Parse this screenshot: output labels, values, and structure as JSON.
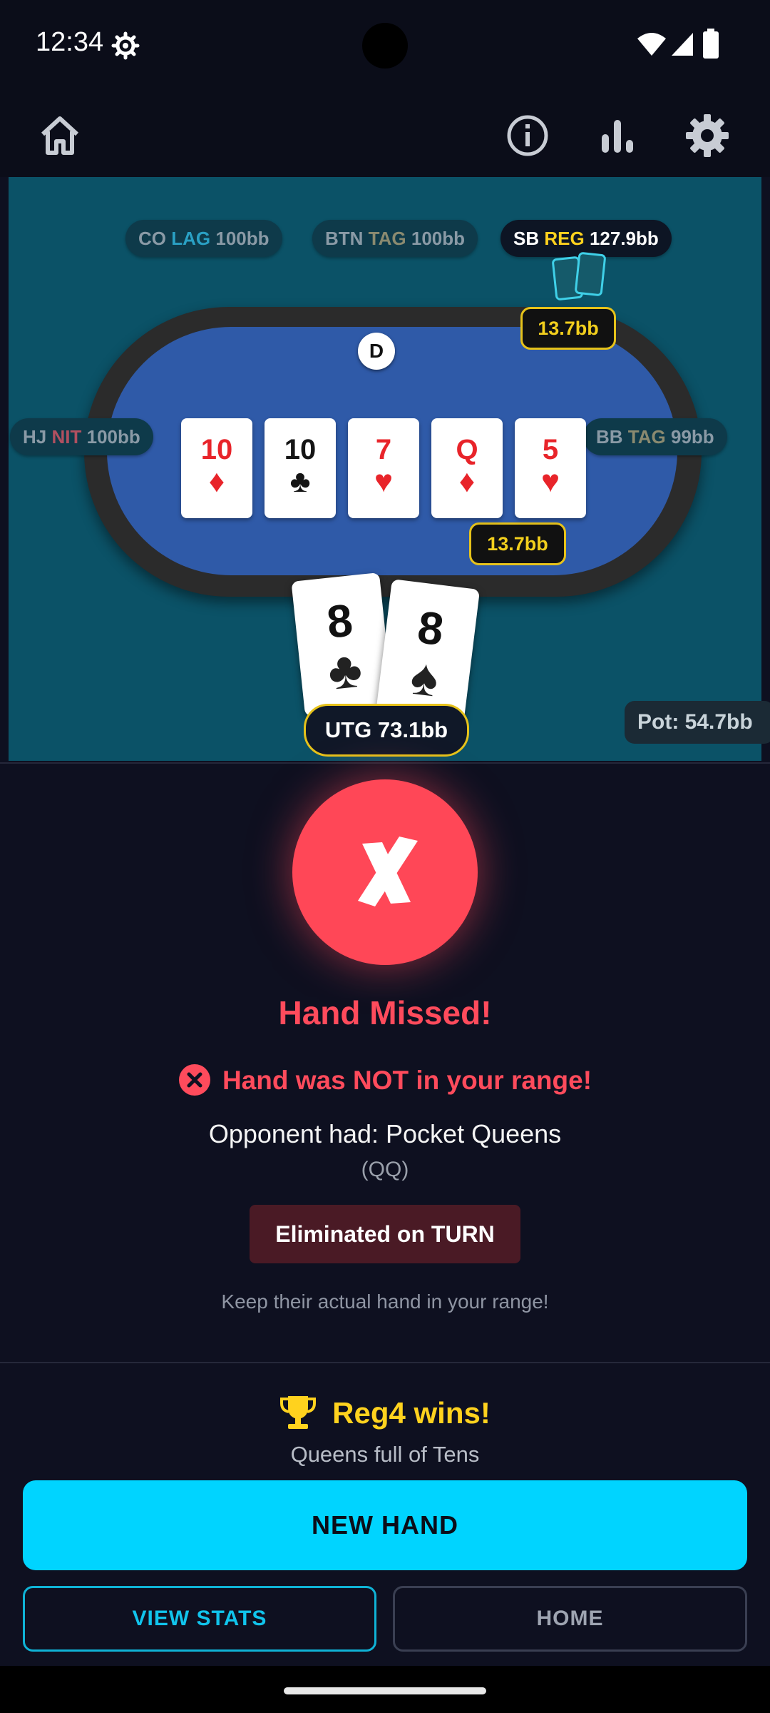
{
  "status_bar": {
    "time": "12:34"
  },
  "colors": {
    "accent": "#00d4ff",
    "error": "#ff4757",
    "gold": "#f2cf1d",
    "felt": "#2f5aa8",
    "background": "#0e1020"
  },
  "app_bar": {
    "icons": [
      "home-icon",
      "info-icon",
      "stats-icon",
      "settings-icon"
    ]
  },
  "table": {
    "seats": {
      "co": {
        "position": "CO",
        "type": "LAG",
        "stack": "100bb",
        "type_color": "#2aa0c4"
      },
      "btn": {
        "position": "BTN",
        "type": "TAG",
        "stack": "100bb",
        "type_color": "#8a8a70"
      },
      "sb": {
        "position": "SB",
        "type": "REG",
        "stack": "127.9bb",
        "type_color": "#ffd21e"
      },
      "hj": {
        "position": "HJ",
        "type": "NIT",
        "stack": "100bb",
        "type_color": "#b05060"
      },
      "bb": {
        "position": "BB",
        "type": "TAG",
        "stack": "99bb",
        "type_color": "#8a8a70"
      }
    },
    "sb_bet": "13.7bb",
    "hero_bet": "13.7bb",
    "dealer_label": "D",
    "board": [
      {
        "rank": "10",
        "suit": "♦",
        "color": "red"
      },
      {
        "rank": "10",
        "suit": "♣",
        "color": "black"
      },
      {
        "rank": "7",
        "suit": "♥",
        "color": "red"
      },
      {
        "rank": "Q",
        "suit": "♦",
        "color": "red"
      },
      {
        "rank": "5",
        "suit": "♥",
        "color": "red"
      }
    ],
    "hero_cards": [
      {
        "rank": "8",
        "suit": "♣"
      },
      {
        "rank": "8",
        "suit": "♠"
      }
    ],
    "hero_label": "UTG 73.1bb",
    "pot": "Pot: 54.7bb"
  },
  "result": {
    "title": "Hand Missed!",
    "range_message": "Hand was NOT in your range!",
    "opponent_had": "Opponent had: Pocket Queens",
    "combo": "(QQ)",
    "eliminated": "Eliminated on TURN",
    "tip": "Keep their actual hand in your range!"
  },
  "winner": {
    "text": "Reg4 wins!",
    "hand": "Queens full of Tens"
  },
  "actions": {
    "new_hand": "NEW HAND",
    "view_stats": "VIEW STATS",
    "home": "HOME"
  }
}
